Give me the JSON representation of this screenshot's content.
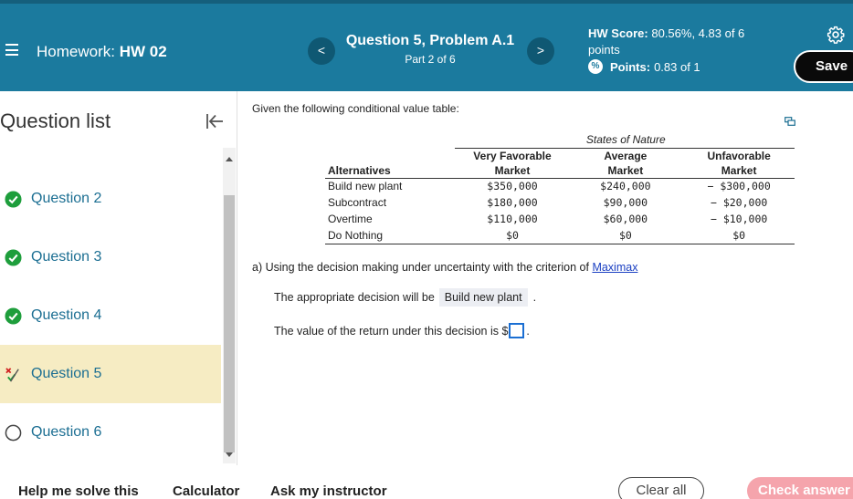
{
  "header": {
    "menu_icon": "hamburger-menu-icon",
    "homework_label": "Homework:",
    "homework_name": "HW 02",
    "question_title": "Question 5, Problem A.1",
    "question_part": "Part 2 of 6",
    "prev_icon": "<",
    "next_icon": ">",
    "hw_score_label": "HW Score:",
    "hw_score_value": "80.56%, 4.83 of 6",
    "hw_score_unit": "points",
    "points_label": "Points:",
    "points_value": "0.83 of 1",
    "save_label": "Save"
  },
  "sidebar": {
    "title": "Question list",
    "items": [
      {
        "label": "Question 2",
        "status": "complete"
      },
      {
        "label": "Question 3",
        "status": "complete"
      },
      {
        "label": "Question 4",
        "status": "complete"
      },
      {
        "label": "Question 5",
        "status": "partial"
      },
      {
        "label": "Question 6",
        "status": "not-started"
      }
    ]
  },
  "main": {
    "intro": "Given the following conditional value table:",
    "table": {
      "states_label": "States of Nature",
      "headers": {
        "alternatives": "Alternatives",
        "vf_line1": "Very Favorable",
        "vf_line2": "Market",
        "avg_line1": "Average",
        "avg_line2": "Market",
        "unf_line1": "Unfavorable",
        "unf_line2": "Market"
      },
      "rows": [
        {
          "alt": "Build new plant",
          "vf": "$350,000",
          "avg": "$240,000",
          "unf": "− $300,000"
        },
        {
          "alt": "Subcontract",
          "vf": "$180,000",
          "avg": "$90,000",
          "unf": "− $20,000"
        },
        {
          "alt": "Overtime",
          "vf": "$110,000",
          "avg": "$60,000",
          "unf": "− $10,000"
        },
        {
          "alt": "Do Nothing",
          "vf": "$0",
          "avg": "$0",
          "unf": "$0"
        }
      ]
    },
    "part_a_prefix": "a) Using the decision making under uncertainty with the criterion of",
    "part_a_link": "Maximax",
    "decision_prefix": "The appropriate decision will be",
    "decision_value": "Build new plant",
    "decision_suffix": ".",
    "return_prefix": "The value of the return under this decision is $",
    "return_value": "",
    "return_suffix": "."
  },
  "footer": {
    "help_label": "Help me solve this",
    "calculator_label": "Calculator",
    "instructor_label": "Ask my instructor",
    "clear_label": "Clear all",
    "check_label": "Check answer"
  },
  "colors": {
    "header_bg": "#1b7a9e",
    "accent_link": "#1b6e92",
    "active_item_bg": "#f6ecc3",
    "check_btn_bg": "#f5a4ac",
    "complete_green": "#1e9e3c",
    "partial_red": "#d02020"
  }
}
